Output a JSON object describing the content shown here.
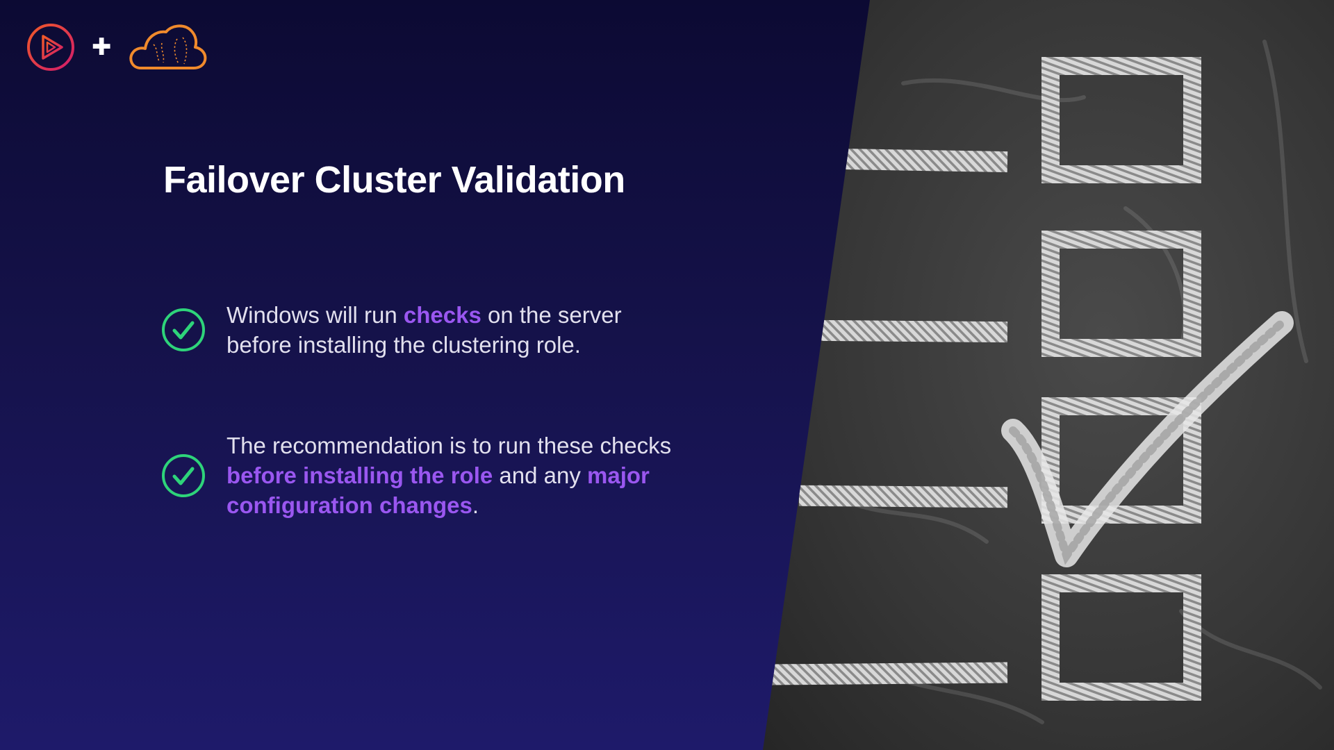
{
  "slide": {
    "title": "Failover Cluster Validation",
    "bullets": [
      {
        "icon": "check-circle-icon",
        "segments": [
          {
            "text": "Windows will run ",
            "highlight": false
          },
          {
            "text": "checks",
            "highlight": true
          },
          {
            "text": " on the server before installing the clustering role.",
            "highlight": false
          }
        ]
      },
      {
        "icon": "check-circle-icon",
        "segments": [
          {
            "text": "The recommendation is to run these checks ",
            "highlight": false
          },
          {
            "text": "before installing the role",
            "highlight": true
          },
          {
            "text": " and any ",
            "highlight": false
          },
          {
            "text": "major configuration changes",
            "highlight": true
          },
          {
            "text": ".",
            "highlight": false
          }
        ]
      }
    ]
  },
  "header": {
    "logos": [
      "play-circle-icon",
      "plus-icon",
      "cloud-icon"
    ]
  },
  "image": {
    "description_icon": "chalkboard-checklist-image"
  },
  "colors": {
    "background_top": "#0c0a33",
    "background_bottom": "#1e1a6a",
    "highlight": "#9a57f0",
    "check": "#2ed47a",
    "logo_play": "#e0284f",
    "logo_cloud": "#f08a2c",
    "chalkboard": "#3a3a3a"
  }
}
